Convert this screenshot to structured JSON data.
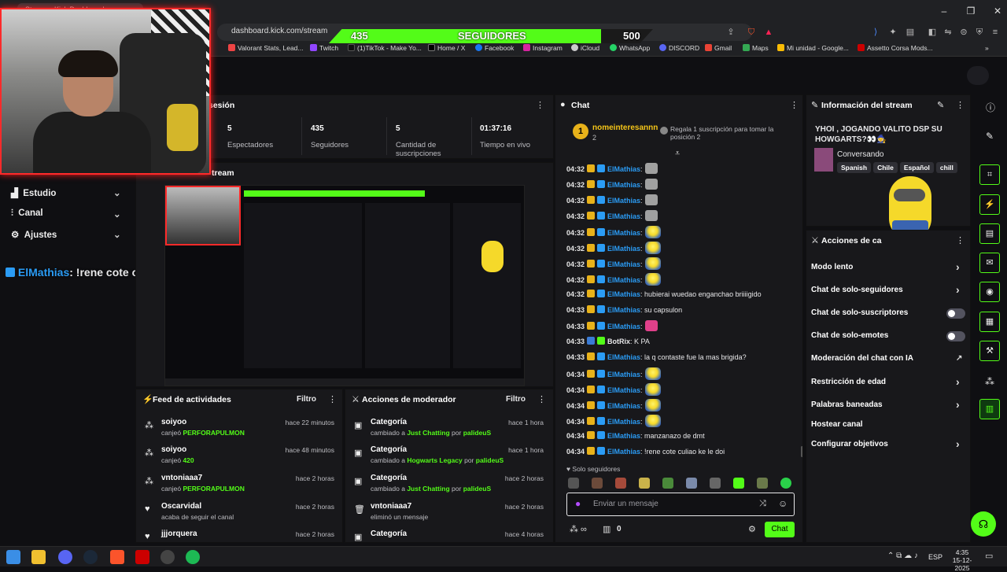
{
  "browser": {
    "tab_title": "Stream - Kick Dashboard",
    "url": "dashboard.kick.com/stream",
    "bookmarks": [
      "Valorant Stats, Lead...",
      "Twitch",
      "(1)TikTok - Make Yo...",
      "Home / X",
      "Facebook",
      "Instagram",
      "iCloud",
      "WhatsApp",
      "DISCORD",
      "Gmail",
      "Maps",
      "Mi unidad - Google...",
      "Assetto Corsa Mods..."
    ]
  },
  "overlay": {
    "followers_current": "435",
    "followers_label": "SEGUIDORES",
    "followers_goal": "500",
    "chat_overlay_user": "ElMathias",
    "chat_overlay_msg": ": !rene cote culiao ke le doi",
    "progress_fraction": 0.87
  },
  "sidebar": {
    "items": [
      {
        "label": "Estudio"
      },
      {
        "label": "Canal"
      },
      {
        "label": "Ajustes"
      }
    ]
  },
  "session": {
    "title": "sesión",
    "stats": [
      {
        "value": "5",
        "label": "Espectadores"
      },
      {
        "value": "435",
        "label": "Seguidores"
      },
      {
        "value": "5",
        "label": "Cantidad de suscripciones"
      },
      {
        "value": "01:37:16",
        "label": "Tiempo en vivo"
      }
    ]
  },
  "stream_preview": {
    "title": "tream"
  },
  "feed": {
    "title": "Feed de actividades",
    "filter": "Filtro",
    "items": [
      {
        "user": "soiyoo",
        "action": "canjeó",
        "item": "PERFORAPULMON",
        "time": "hace 22 minutos"
      },
      {
        "user": "soiyoo",
        "action": "canjeó",
        "item": "420",
        "time": "hace 48 minutos"
      },
      {
        "user": "vntoniaaa7",
        "action": "canjeó",
        "item": "PERFORAPULMON",
        "time": "hace 2 horas"
      },
      {
        "user": "Oscarvidal",
        "action": "acaba de seguir el canal",
        "item": "",
        "time": "hace 2 horas"
      },
      {
        "user": "jjjorquera",
        "action": "",
        "item": "",
        "time": "hace 2 horas"
      }
    ]
  },
  "mod_actions": {
    "title": "Acciones de moderador",
    "filter": "Filtro",
    "items": [
      {
        "title": "Categoría",
        "pre": "cambiado a",
        "cat": "Just Chatting",
        "by": "por",
        "user": "palideuS",
        "time": "hace 1 hora"
      },
      {
        "title": "Categoría",
        "pre": "cambiado a",
        "cat": "Hogwarts Legacy",
        "by": "por",
        "user": "palideuS",
        "time": "hace 1 hora"
      },
      {
        "title": "Categoría",
        "pre": "cambiado a",
        "cat": "Just Chatting",
        "by": "por",
        "user": "palideuS",
        "time": "hace 2 horas"
      },
      {
        "title": "vntoniaaa7",
        "pre": "eliminó un mensaje",
        "cat": "",
        "by": "",
        "user": "",
        "time": "hace 2 horas"
      },
      {
        "title": "Categoría",
        "pre": "",
        "cat": "",
        "by": "",
        "user": "",
        "time": "hace 4 horas"
      }
    ]
  },
  "chat": {
    "title": "Chat",
    "pinned_user": "nomeinteresannn",
    "pinned_count": "2",
    "pinned_msg": "Regala 1 suscripción para tomar la posición 2",
    "lines": [
      {
        "ts": "04:32",
        "user": "ElMathias",
        "msg": ":",
        "emote": "small"
      },
      {
        "ts": "04:32",
        "user": "ElMathias",
        "msg": ":",
        "emote": "small"
      },
      {
        "ts": "04:32",
        "user": "ElMathias",
        "msg": ":",
        "emote": "small"
      },
      {
        "ts": "04:32",
        "user": "ElMathias",
        "msg": ":",
        "emote": "small"
      },
      {
        "ts": "04:32",
        "user": "ElMathias",
        "msg": ":",
        "emote": "minion"
      },
      {
        "ts": "04:32",
        "user": "ElMathias",
        "msg": ":",
        "emote": "minion"
      },
      {
        "ts": "04:32",
        "user": "ElMathias",
        "msg": ":",
        "emote": "minion"
      },
      {
        "ts": "04:32",
        "user": "ElMathias",
        "msg": ":",
        "emote": "minion"
      },
      {
        "ts": "04:32",
        "user": "ElMathias",
        "msg": ": hubierai wuedao enganchao briiiigido",
        "emote": ""
      },
      {
        "ts": "04:33",
        "user": "ElMathias",
        "msg": ": su capsulon",
        "emote": ""
      },
      {
        "ts": "04:33",
        "user": "ElMathias",
        "msg": ":",
        "emote": "pink"
      },
      {
        "ts": "04:33",
        "user": "BotRix",
        "msg": ": K PA",
        "emote": ""
      },
      {
        "ts": "04:33",
        "user": "ElMathias",
        "msg": ": la q contaste fue la mas brigida?",
        "emote": ""
      },
      {
        "ts": "04:34",
        "user": "ElMathias",
        "msg": ":",
        "emote": "minion"
      },
      {
        "ts": "04:34",
        "user": "ElMathias",
        "msg": ":",
        "emote": "minion"
      },
      {
        "ts": "04:34",
        "user": "ElMathias",
        "msg": ":",
        "emote": "minion"
      },
      {
        "ts": "04:34",
        "user": "ElMathias",
        "msg": ":",
        "emote": "minion"
      },
      {
        "ts": "04:34",
        "user": "ElMathias",
        "msg": ": manzanazo de dmt",
        "emote": ""
      },
      {
        "ts": "04:34",
        "user": "ElMathias",
        "msg": ": !rene cote culiao ke le doi",
        "emote": ""
      }
    ],
    "mode_label": "Solo seguidores",
    "input_placeholder": "Enviar un mensaje",
    "points": "0",
    "send_label": "Chat"
  },
  "stream_info": {
    "title": "Información del stream",
    "stream_title": "YHOI , JOGANDO VALITO DSP SU HOWGARTS?👀🧙",
    "category": "Conversando",
    "tags": [
      "Spanish",
      "Chile",
      "Español",
      "chill"
    ],
    "emote_label": "X4"
  },
  "channel_actions": {
    "title": "Acciones de ca",
    "items": [
      {
        "label": "Modo lento",
        "control": "chevron"
      },
      {
        "label": "Chat de solo-seguidores",
        "control": "chevron"
      },
      {
        "label": "Chat de solo-suscriptores",
        "control": "toggle"
      },
      {
        "label": "Chat de solo-emotes",
        "control": "toggle"
      },
      {
        "label": "Moderación del chat con IA",
        "control": "external"
      },
      {
        "label": "Restricción de edad",
        "control": "chevron"
      },
      {
        "label": "Palabras baneadas",
        "control": "chevron"
      },
      {
        "label": "Hostear canal",
        "control": "none"
      },
      {
        "label": "Configurar objetivos",
        "control": "chevron"
      }
    ]
  },
  "taskbar": {
    "lang": "ESP",
    "time": "4:35",
    "date": "15-12-2025"
  },
  "colors": {
    "accent": "#53fc18",
    "username": "#2b9cf5",
    "webcam_border": "#ff2a2a",
    "panel": "#18181b"
  }
}
